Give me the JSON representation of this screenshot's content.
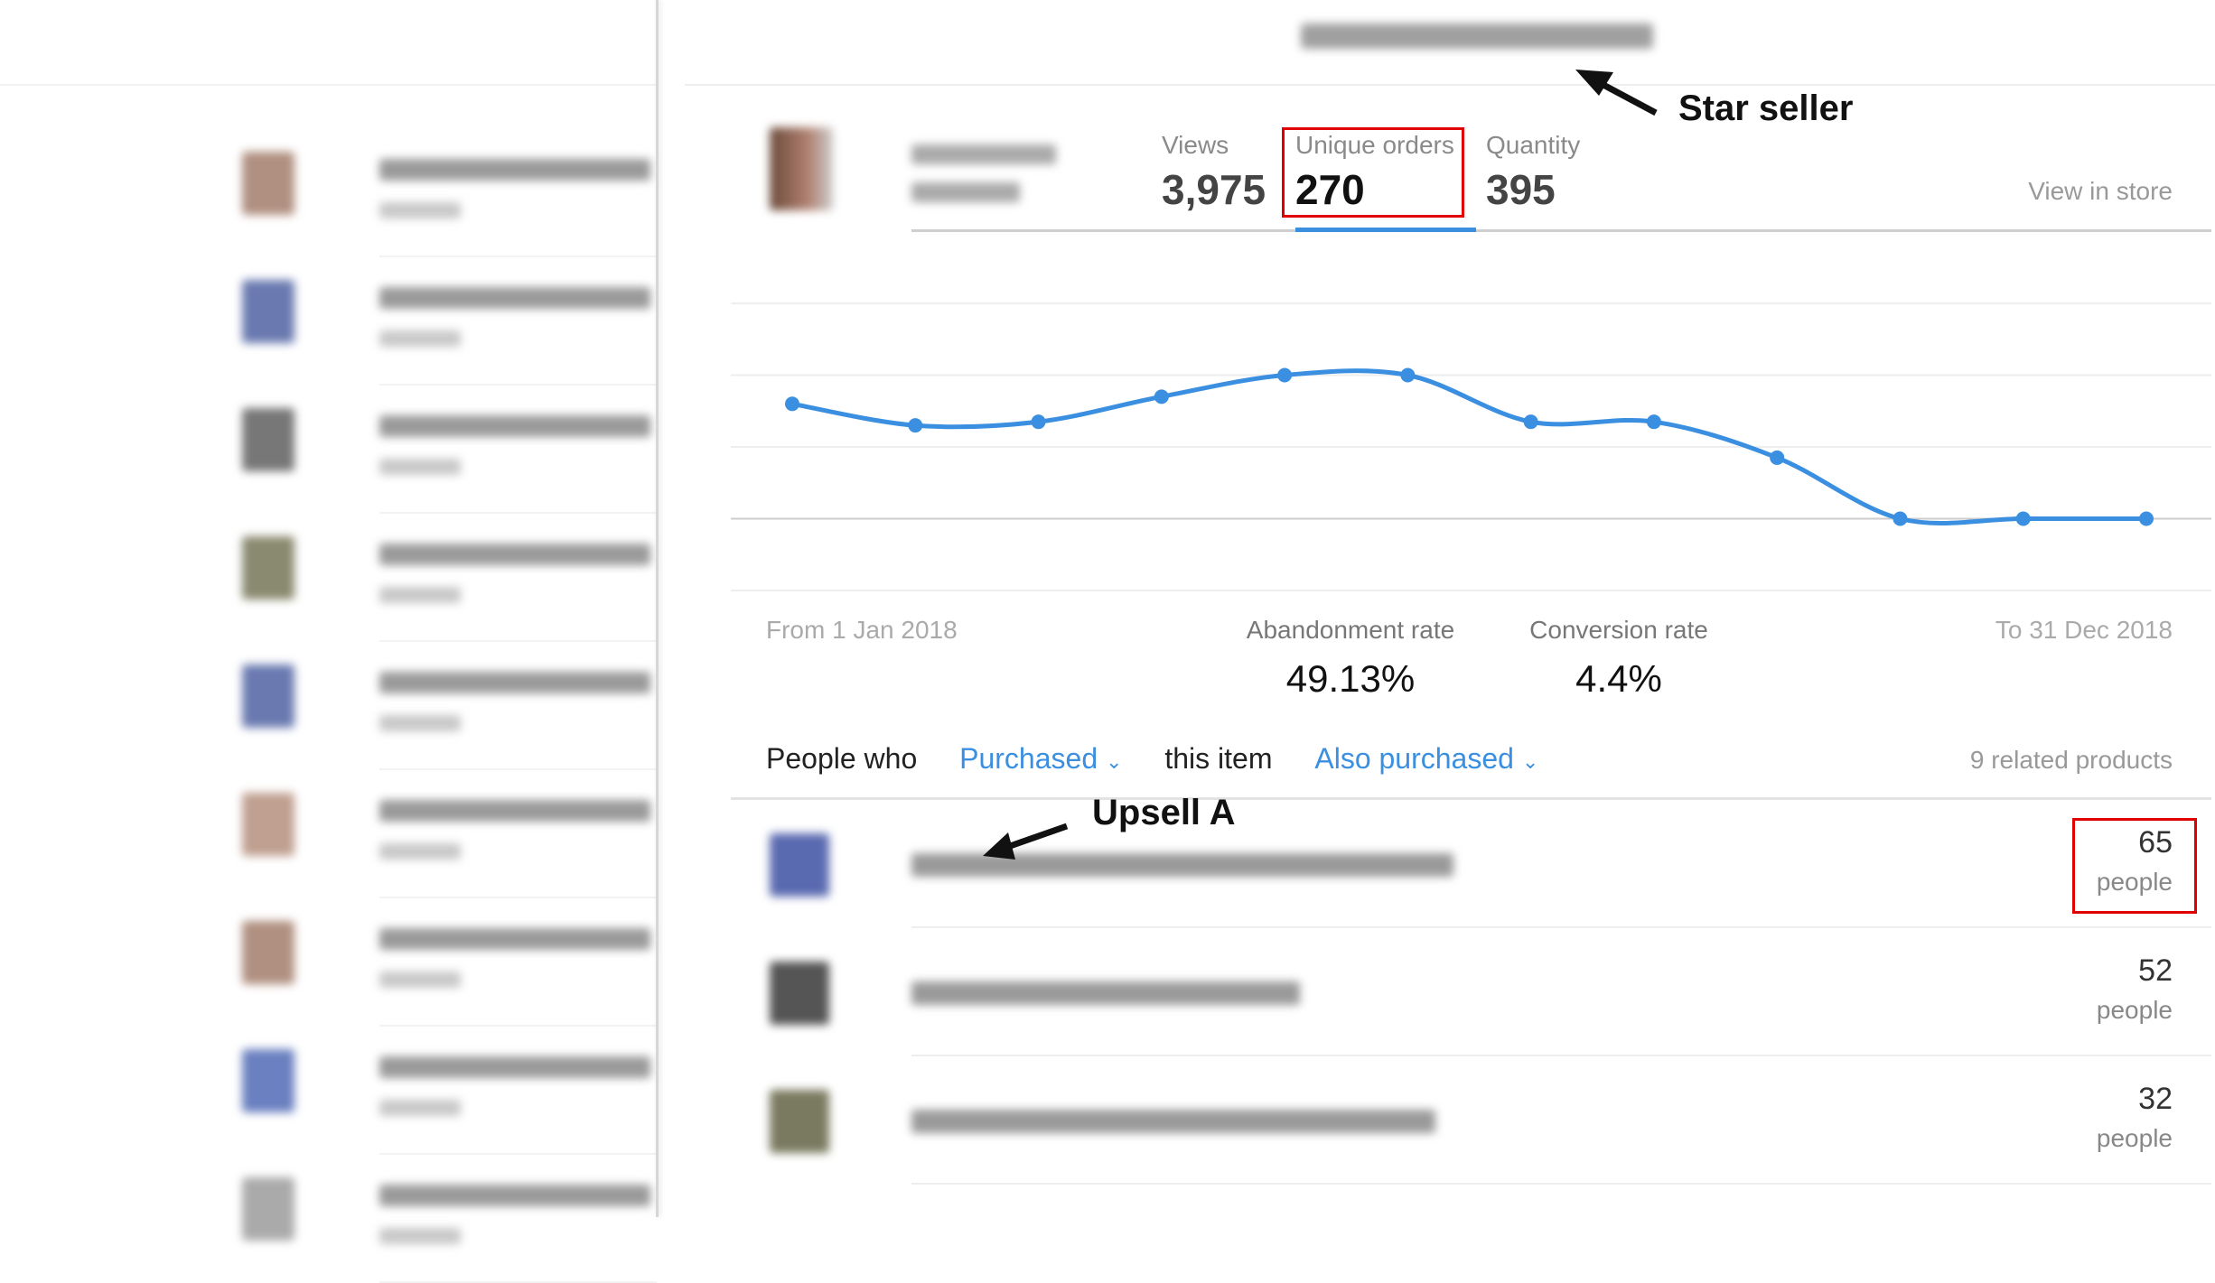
{
  "product_stats": {
    "views": {
      "label": "Views",
      "value": "3,975"
    },
    "unique_orders": {
      "label": "Unique orders",
      "value": "270"
    },
    "quantity": {
      "label": "Quantity",
      "value": "395"
    },
    "view_in_store": "View in store",
    "active_tab": "unique_orders"
  },
  "date_range": {
    "from": "From 1 Jan 2018",
    "to": "To 31 Dec 2018"
  },
  "rates": {
    "abandonment": {
      "label": "Abandonment rate",
      "value": "49.13%"
    },
    "conversion": {
      "label": "Conversion rate",
      "value": "4.4%"
    }
  },
  "filter": {
    "prefix": "People who",
    "action": "Purchased",
    "middle": "this item",
    "relation": "Also purchased",
    "count": "9 related products"
  },
  "related": [
    {
      "count": "65",
      "unit": "people"
    },
    {
      "count": "52",
      "unit": "people"
    },
    {
      "count": "32",
      "unit": "people"
    }
  ],
  "annotations": {
    "star": "Star seller",
    "upsell": "Upsell A"
  },
  "colors": {
    "accent": "#3b8fe0",
    "highlight": "#e00000"
  },
  "chart_data": {
    "type": "line",
    "title": "",
    "xlabel": "",
    "ylabel": "",
    "ylim": [
      -1,
      3
    ],
    "grid": true,
    "series": [
      {
        "values": [
          1.6,
          1.3,
          1.35,
          1.7,
          2.0,
          2.0,
          1.35,
          1.35,
          0.85,
          0,
          0,
          0
        ]
      }
    ]
  }
}
